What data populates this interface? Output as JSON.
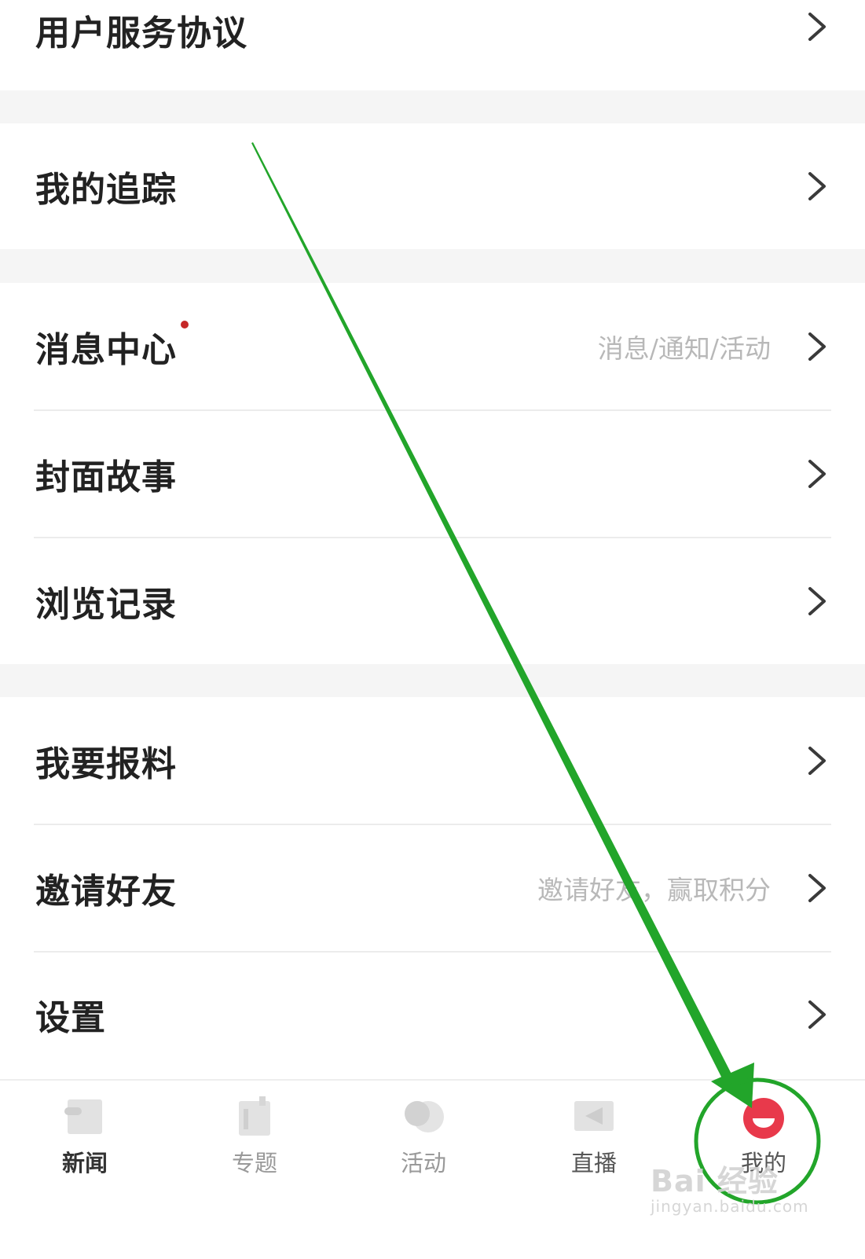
{
  "menu": {
    "user_agreement": "用户服务协议",
    "my_tracking": "我的追踪",
    "message_center": {
      "label": "消息中心",
      "hint": "消息/通知/活动",
      "has_unread": true
    },
    "cover_story": "封面故事",
    "history": "浏览记录",
    "report_news": "我要报料",
    "invite_friends": {
      "label": "邀请好友",
      "hint": "邀请好友，赢取积分"
    },
    "settings": "设置"
  },
  "tabbar": {
    "tabs": [
      {
        "label": "新闻",
        "icon": "news-icon",
        "active": false
      },
      {
        "label": "专题",
        "icon": "topic-icon",
        "active": false
      },
      {
        "label": "活动",
        "icon": "activity-icon",
        "active": false
      },
      {
        "label": "直播",
        "icon": "live-icon",
        "active": false
      },
      {
        "label": "我的",
        "icon": "profile-icon",
        "active": true
      }
    ]
  },
  "annotation": {
    "color": "#22a52a",
    "highlight_target": "我的"
  },
  "watermark": {
    "main": "Bai 经验",
    "sub": "jingyan.baidu.com"
  },
  "colors": {
    "accent": "#e8394b",
    "unread_dot": "#c62828",
    "divider": "#ececec",
    "section_gap": "#f5f5f5"
  }
}
